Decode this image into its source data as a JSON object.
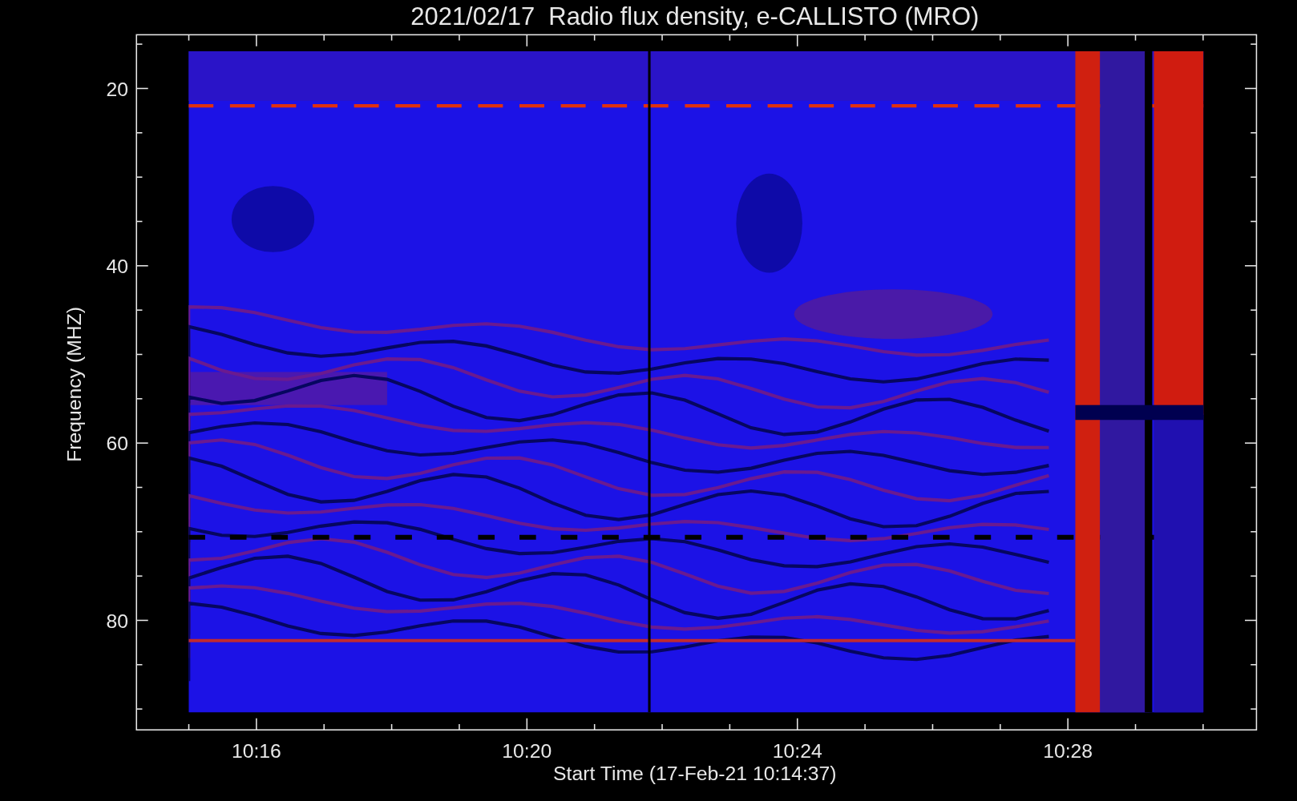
{
  "title": "2021/02/17  Radio flux density, e-CALLISTO (MRO)",
  "y_axis": {
    "label": "Frequency (MHZ)",
    "ticks": [
      "20",
      "40",
      "60",
      "80"
    ]
  },
  "x_axis": {
    "label": "Start Time (17-Feb-21 10:14:37)",
    "ticks": [
      "10:16",
      "10:20",
      "10:24",
      "10:28"
    ]
  }
}
